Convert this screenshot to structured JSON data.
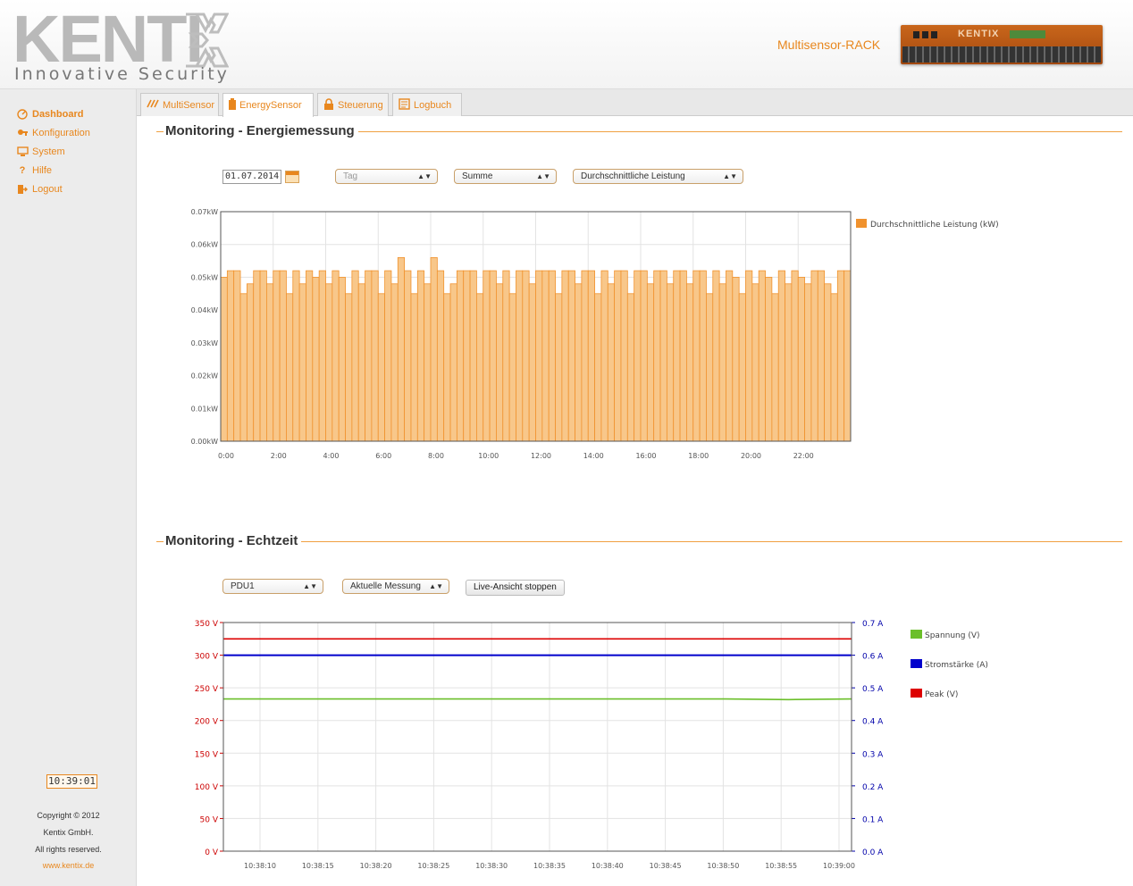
{
  "header": {
    "logo_word": "KENTI",
    "logo_tagline": "Innovative Security",
    "device_name": "Multisensor-RACK",
    "device_brand": "KENTIX"
  },
  "sidebar": {
    "items": [
      {
        "label": "Dashboard",
        "icon": "dashboard-icon"
      },
      {
        "label": "Konfiguration",
        "icon": "key-icon"
      },
      {
        "label": "System",
        "icon": "monitor-icon"
      },
      {
        "label": "Hilfe",
        "icon": "help-icon"
      },
      {
        "label": "Logout",
        "icon": "logout-icon"
      }
    ],
    "clock": "10:39:01",
    "copyright": [
      "Copyright © 2012",
      "Kentix GmbH.",
      "All rights reserved."
    ],
    "link": "www.kentix.de"
  },
  "tabs": [
    {
      "label": "MultiSensor",
      "icon": "multisensor-icon",
      "active": false
    },
    {
      "label": "EnergySensor",
      "icon": "battery-icon",
      "active": true
    },
    {
      "label": "Steuerung",
      "icon": "lock-icon",
      "active": false
    },
    {
      "label": "Logbuch",
      "icon": "logbook-icon",
      "active": false
    }
  ],
  "energy": {
    "title": "Monitoring - Energiemessung",
    "date": "01.07.2014",
    "period": "Tag",
    "mode": "Summe",
    "metric": "Durchschnittliche Leistung"
  },
  "realtime": {
    "title": "Monitoring - Echtzeit",
    "device": "PDU1",
    "measurement": "Aktuelle Messung",
    "stop_button": "Live-Ansicht stoppen"
  },
  "chart_data": [
    {
      "type": "bar",
      "y_unit": "kW",
      "ylim": [
        0,
        0.07
      ],
      "y_ticks": [
        "0.00kW",
        "0.01kW",
        "0.02kW",
        "0.03kW",
        "0.04kW",
        "0.05kW",
        "0.06kW",
        "0.07kW"
      ],
      "x_ticks": [
        "0:00",
        "2:00",
        "4:00",
        "6:00",
        "8:00",
        "10:00",
        "12:00",
        "14:00",
        "16:00",
        "18:00",
        "20:00",
        "22:00"
      ],
      "series": [
        {
          "name": "Durchschnittliche Leistung (kW)",
          "color": "#f5a94e",
          "values": [
            0.05,
            0.052,
            0.052,
            0.045,
            0.048,
            0.052,
            0.052,
            0.048,
            0.052,
            0.052,
            0.045,
            0.052,
            0.048,
            0.052,
            0.05,
            0.052,
            0.048,
            0.052,
            0.05,
            0.045,
            0.052,
            0.048,
            0.052,
            0.052,
            0.045,
            0.052,
            0.048,
            0.056,
            0.052,
            0.045,
            0.052,
            0.048,
            0.056,
            0.052,
            0.045,
            0.048,
            0.052,
            0.052,
            0.052,
            0.045,
            0.052,
            0.052,
            0.048,
            0.052,
            0.045,
            0.052,
            0.052,
            0.048,
            0.052,
            0.052,
            0.052,
            0.045,
            0.052,
            0.052,
            0.048,
            0.052,
            0.052,
            0.045,
            0.052,
            0.048,
            0.052,
            0.052,
            0.045,
            0.052,
            0.052,
            0.048,
            0.052,
            0.052,
            0.048,
            0.052,
            0.052,
            0.048,
            0.052,
            0.052,
            0.045,
            0.052,
            0.048,
            0.052,
            0.05,
            0.045,
            0.052,
            0.048,
            0.052,
            0.05,
            0.045,
            0.052,
            0.048,
            0.052,
            0.05,
            0.048,
            0.052,
            0.052,
            0.048,
            0.045,
            0.052,
            0.052
          ]
        }
      ],
      "legend": "right"
    },
    {
      "type": "line",
      "x_ticks": [
        "10:38:10",
        "10:38:15",
        "10:38:20",
        "10:38:25",
        "10:38:30",
        "10:38:35",
        "10:38:40",
        "10:38:45",
        "10:38:50",
        "10:38:55",
        "10:39:00"
      ],
      "y_left": {
        "ylim": [
          0,
          350
        ],
        "ticks": [
          "0 V",
          "50 V",
          "100 V",
          "150 V",
          "200 V",
          "250 V",
          "300 V",
          "350 V"
        ],
        "color": "#cc0000"
      },
      "y_right": {
        "ylim": [
          0,
          0.7
        ],
        "ticks": [
          "0.0 A",
          "0.1 A",
          "0.2 A",
          "0.3 A",
          "0.4 A",
          "0.5 A",
          "0.6 A",
          "0.7 A"
        ],
        "color": "#0000aa"
      },
      "series": [
        {
          "name": "Spannung (V)",
          "color": "#6bbf2a",
          "axis": "left",
          "values": [
            233,
            233,
            233,
            233,
            233,
            233,
            233,
            233,
            233,
            232,
            233
          ]
        },
        {
          "name": "Stromstärke (A)",
          "color": "#0000cc",
          "axis": "right",
          "values": [
            0.6,
            0.6,
            0.6,
            0.6,
            0.6,
            0.6,
            0.6,
            0.6,
            0.6,
            0.6,
            0.6
          ]
        },
        {
          "name": "Peak (V)",
          "color": "#dd0000",
          "axis": "left",
          "values": [
            325,
            325,
            325,
            325,
            325,
            325,
            325,
            325,
            325,
            325,
            325
          ]
        }
      ],
      "legend": "right"
    }
  ]
}
